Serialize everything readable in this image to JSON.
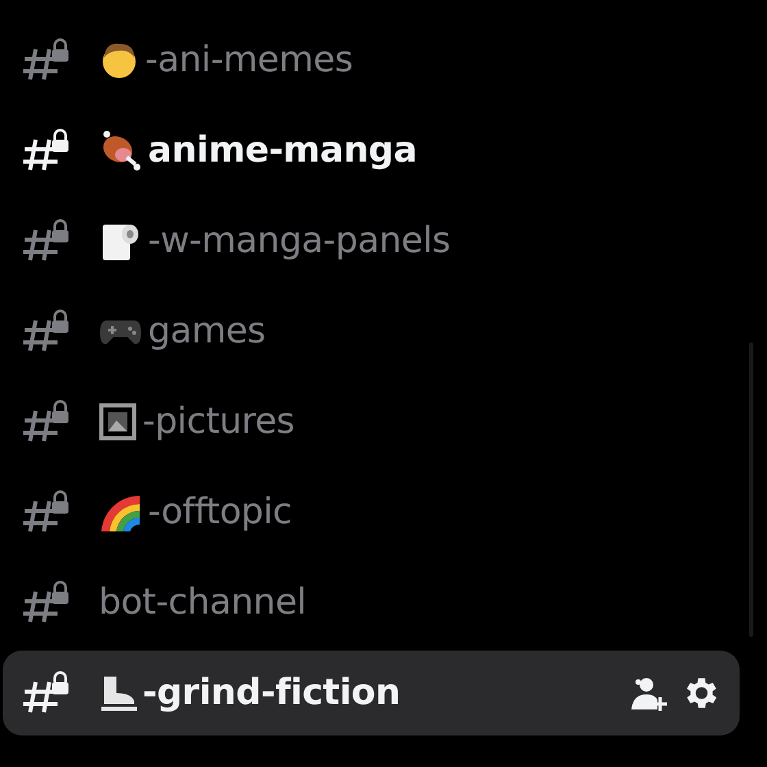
{
  "channels": [
    {
      "kind": "face",
      "name": "-ani-memes",
      "unread": false,
      "selected": false
    },
    {
      "kind": "meat",
      "name": "anime-manga",
      "unread": true,
      "selected": false
    },
    {
      "kind": "roll",
      "name": "-w-manga-panels",
      "unread": false,
      "selected": false
    },
    {
      "kind": "controller",
      "name": "games",
      "unread": false,
      "selected": false
    },
    {
      "kind": "frame",
      "name": "-pictures",
      "unread": false,
      "selected": false
    },
    {
      "kind": "rainbow",
      "name": "-offtopic",
      "unread": false,
      "selected": false
    },
    {
      "kind": "plain",
      "name": "bot-channel",
      "unread": false,
      "selected": false
    },
    {
      "kind": "skate",
      "name": "-grind-fiction",
      "unread": true,
      "selected": true
    }
  ]
}
